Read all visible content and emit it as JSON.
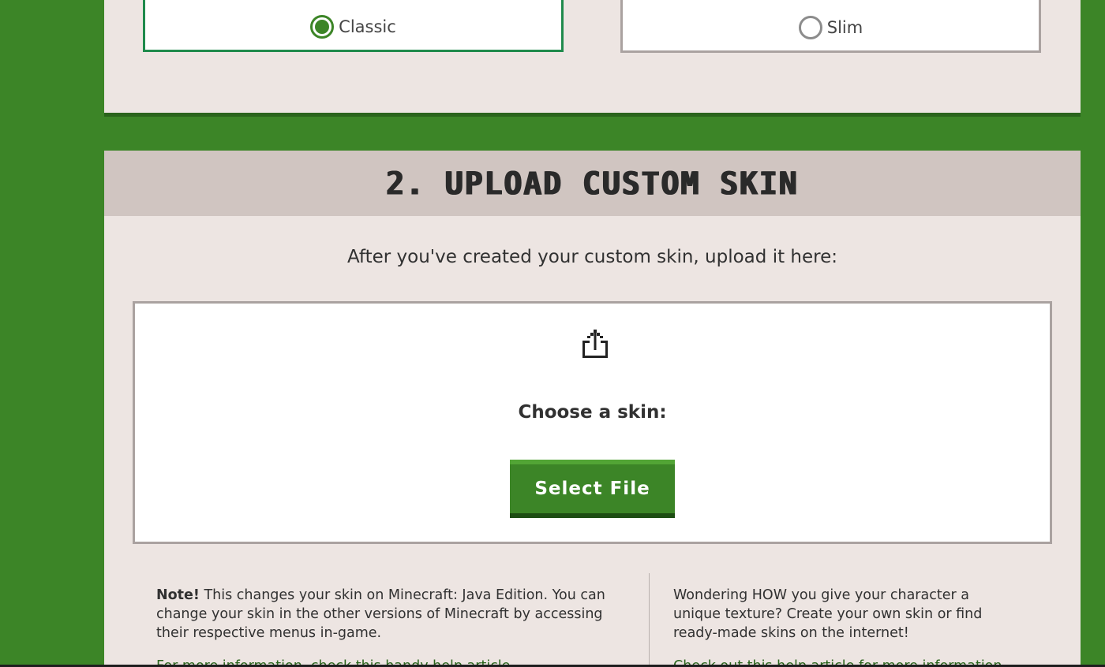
{
  "model": {
    "options": [
      {
        "label": "Classic",
        "selected": true
      },
      {
        "label": "Slim",
        "selected": false
      }
    ]
  },
  "upload": {
    "title": "2. Upload Custom Skin",
    "intro": "After you've created your custom skin, upload it here:",
    "icon": "upload-icon",
    "choose_label": "Choose a skin:",
    "button_label": "Select File"
  },
  "notes": {
    "left_bold": "Note!",
    "left_text": " This changes your skin on Minecraft: Java Edition. You can change your skin in the other versions of Minecraft by accessing their respective menus in-game.",
    "left_link": "For more information, check this handy help article.",
    "right_text": "Wondering HOW you give your character a unique texture? Create your own skin or find ready-made skins on the internet!",
    "right_link": "Check out this help article for more information."
  },
  "colors": {
    "page_bg": "#3c8527",
    "card_bg": "#ede5e2",
    "header_bg": "#d0c5c1",
    "accent": "#3c8527",
    "link": "#2a641c"
  }
}
